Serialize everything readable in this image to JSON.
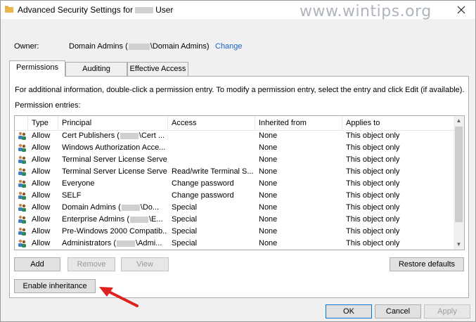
{
  "window": {
    "title_prefix": "Advanced Security Settings for",
    "title_suffix": "User",
    "watermark": "www.wintips.org"
  },
  "owner": {
    "label": "Owner:",
    "value_prefix": "Domain Admins (",
    "value_suffix": "\\Domain Admins)",
    "change_label": "Change"
  },
  "tabs": [
    {
      "label": "Permissions",
      "active": true
    },
    {
      "label": "Auditing",
      "active": false
    },
    {
      "label": "Effective Access",
      "active": false
    }
  ],
  "permissions": {
    "info_text": "For additional information, double-click a permission entry. To modify a permission entry, select the entry and click Edit (if available).",
    "entries_label": "Permission entries:",
    "columns": [
      "Type",
      "Principal",
      "Access",
      "Inherited from",
      "Applies to"
    ],
    "rows": [
      {
        "icon": "users-icon",
        "type": "Allow",
        "principal_pre": "Cert Publishers (",
        "redacted": true,
        "principal_post": "\\Cert ...",
        "access": "",
        "inherited": "None",
        "applies": "This object only"
      },
      {
        "icon": "users-icon",
        "type": "Allow",
        "principal_pre": "Windows Authorization Acce...",
        "redacted": false,
        "principal_post": "",
        "access": "",
        "inherited": "None",
        "applies": "This object only"
      },
      {
        "icon": "users-icon",
        "type": "Allow",
        "principal_pre": "Terminal Server License Serve...",
        "redacted": false,
        "principal_post": "",
        "access": "",
        "inherited": "None",
        "applies": "This object only"
      },
      {
        "icon": "users-icon",
        "type": "Allow",
        "principal_pre": "Terminal Server License Serve...",
        "redacted": false,
        "principal_post": "",
        "access": "Read/write Terminal S...",
        "inherited": "None",
        "applies": "This object only"
      },
      {
        "icon": "users-icon",
        "type": "Allow",
        "principal_pre": "Everyone",
        "redacted": false,
        "principal_post": "",
        "access": "Change password",
        "inherited": "None",
        "applies": "This object only"
      },
      {
        "icon": "users-icon",
        "type": "Allow",
        "principal_pre": "SELF",
        "redacted": false,
        "principal_post": "",
        "access": "Change password",
        "inherited": "None",
        "applies": "This object only"
      },
      {
        "icon": "users-icon",
        "type": "Allow",
        "principal_pre": "Domain Admins (",
        "redacted": true,
        "principal_post": "\\Do...",
        "access": "Special",
        "inherited": "None",
        "applies": "This object only"
      },
      {
        "icon": "users-icon",
        "type": "Allow",
        "principal_pre": "Enterprise Admins (",
        "redacted": true,
        "principal_post": "\\E...",
        "access": "Special",
        "inherited": "None",
        "applies": "This object only"
      },
      {
        "icon": "users-icon",
        "type": "Allow",
        "principal_pre": "Pre-Windows 2000 Compatib...",
        "redacted": false,
        "principal_post": "",
        "access": "Special",
        "inherited": "None",
        "applies": "This object only"
      },
      {
        "icon": "users-icon",
        "type": "Allow",
        "principal_pre": "Administrators (",
        "redacted": true,
        "principal_post": "\\Admi...",
        "access": "Special",
        "inherited": "None",
        "applies": "This object only"
      }
    ]
  },
  "buttons": {
    "add": "Add",
    "remove": "Remove",
    "view": "View",
    "restore_defaults": "Restore defaults",
    "enable_inheritance": "Enable inheritance",
    "ok": "OK",
    "cancel": "Cancel",
    "apply": "Apply"
  },
  "colors": {
    "link": "#1a64c8",
    "arrow": "#e02020"
  }
}
